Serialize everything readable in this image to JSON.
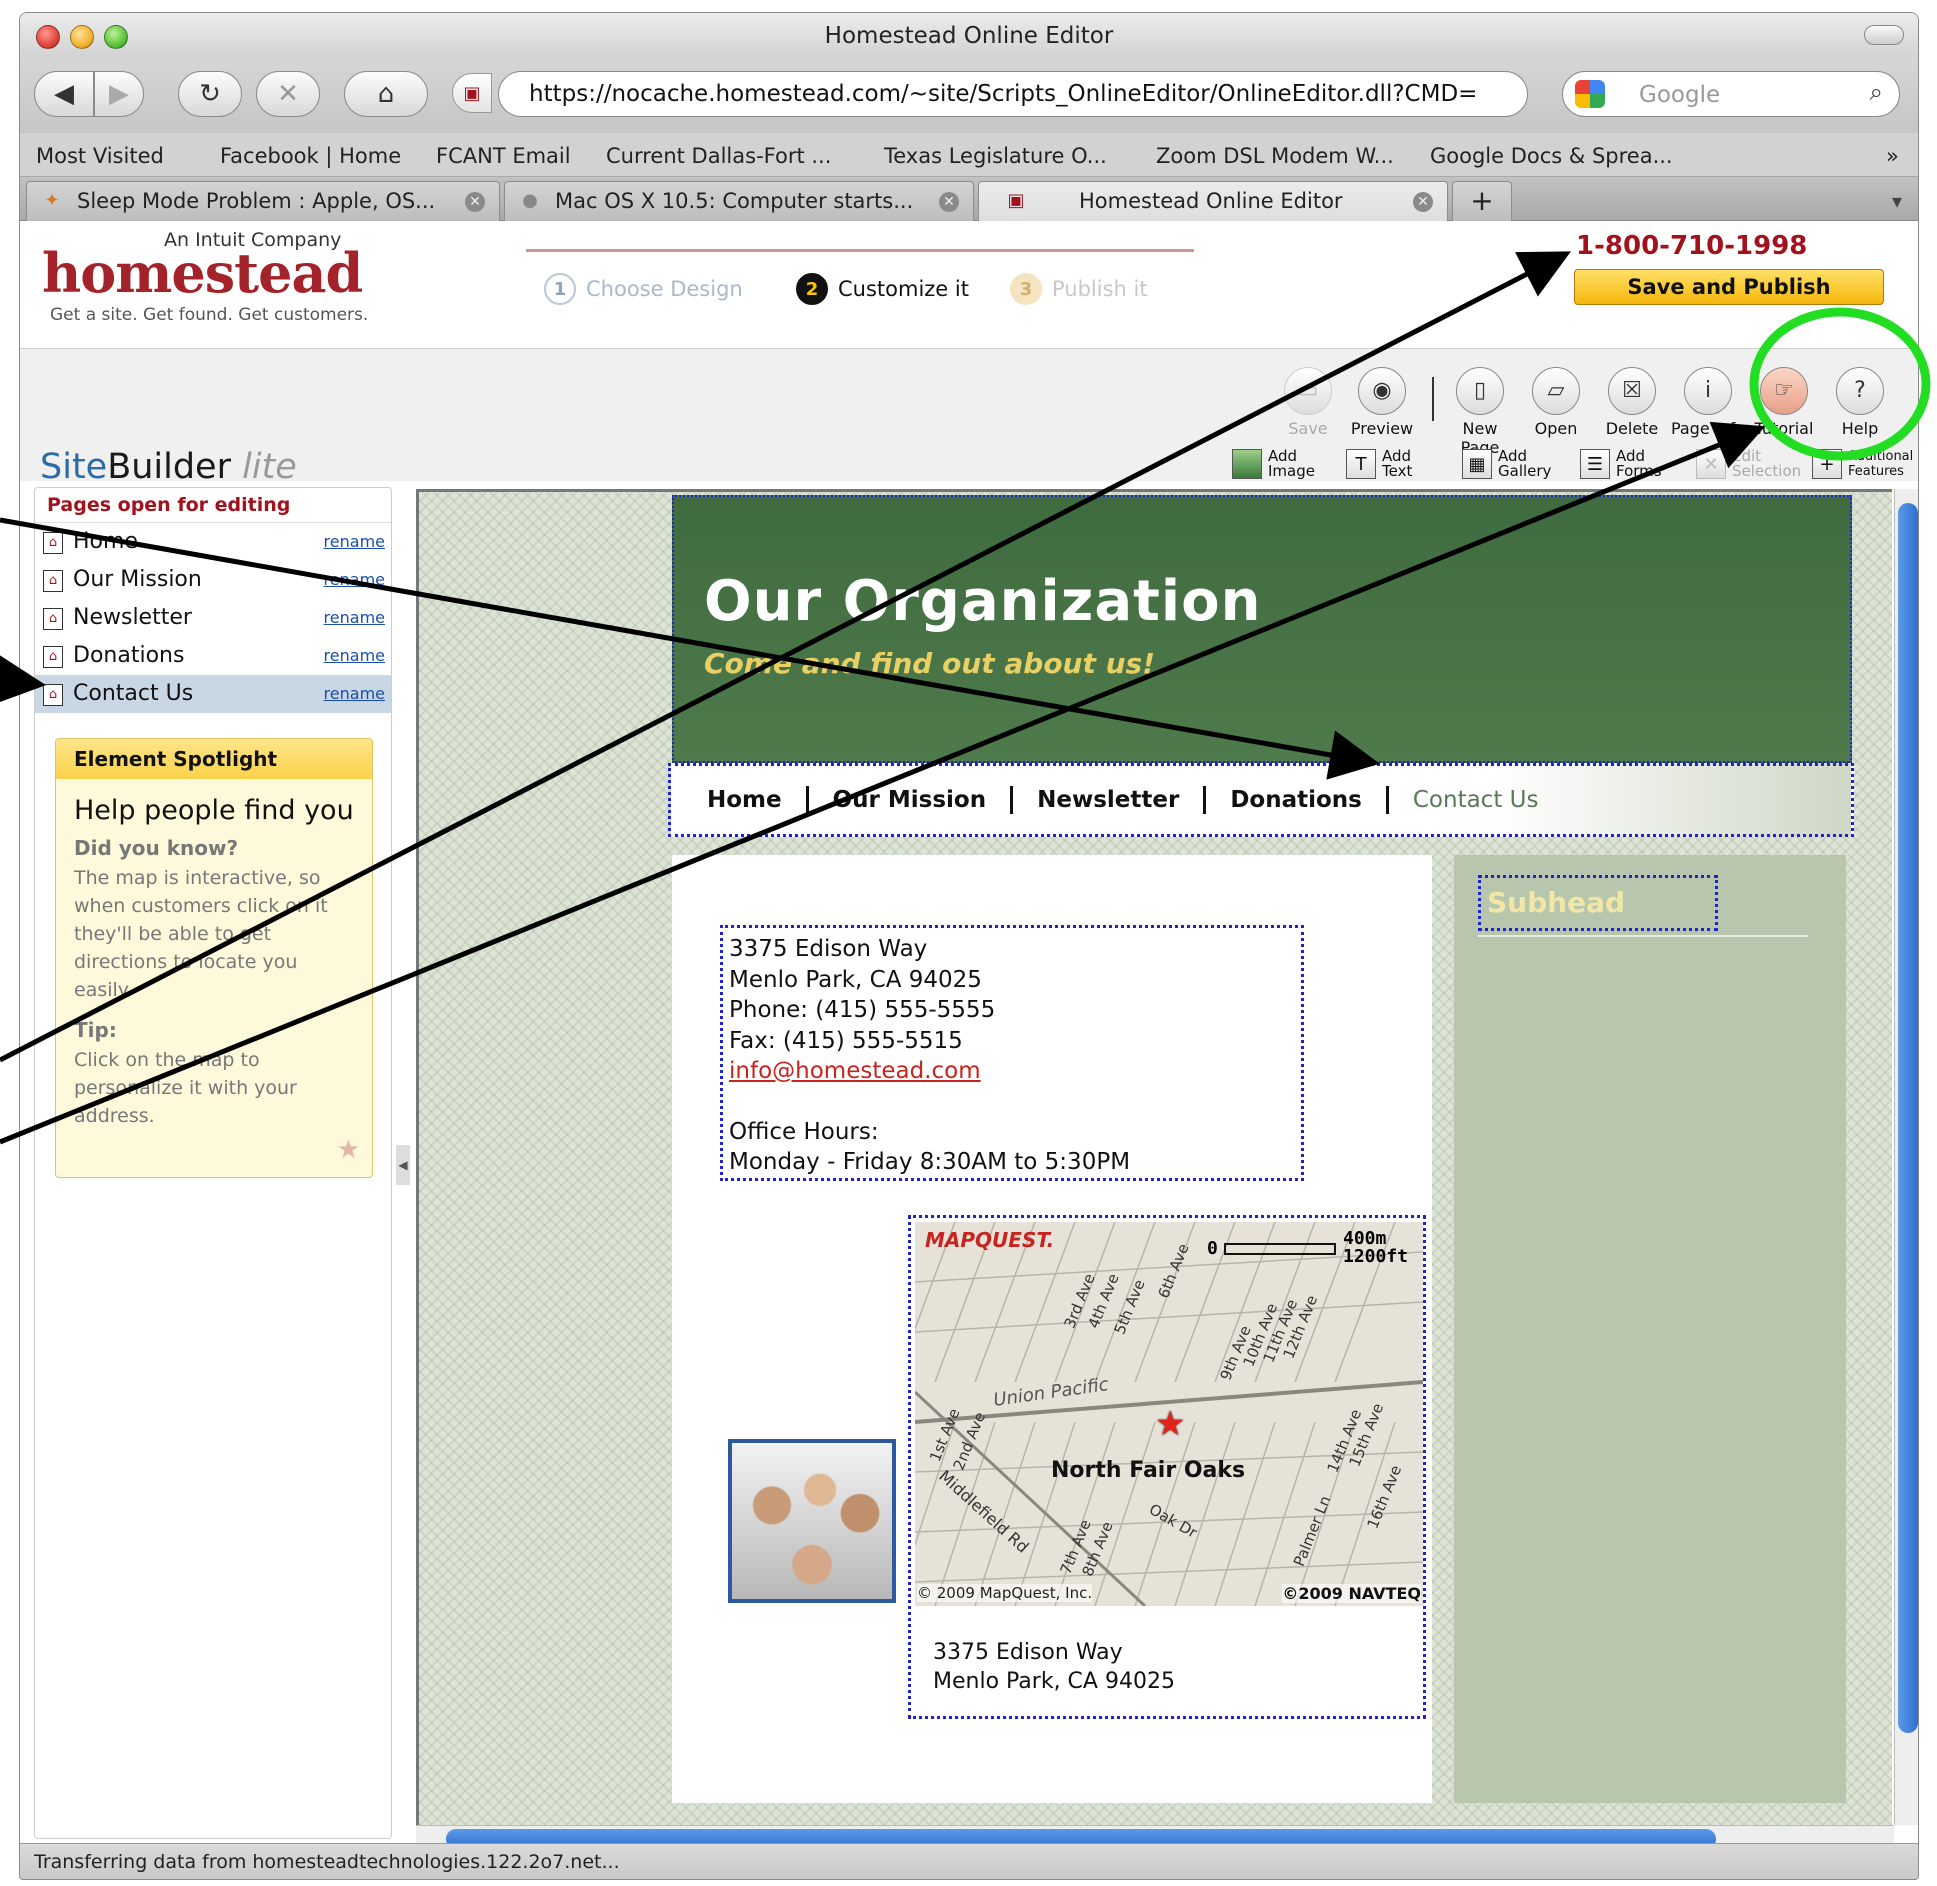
{
  "window": {
    "title": "Homestead Online Editor"
  },
  "nav": {
    "url": "https://nocache.homestead.com/~site/Scripts_OnlineEditor/OnlineEditor.dll?CMD=",
    "search_placeholder": "Google"
  },
  "bookmarks": [
    "Most Visited",
    "Facebook | Home",
    "FCANT Email",
    "Current Dallas-Fort ...",
    "Texas Legislature O...",
    "Zoom DSL Modem W...",
    "Google Docs & Sprea..."
  ],
  "tabs": [
    "Sleep Mode Problem : Apple, OS...",
    "Mac OS X 10.5: Computer starts...",
    "Homestead Online Editor"
  ],
  "header": {
    "brand_top": "An Intuit Company",
    "brand": "homestead",
    "tagline": "Get a site. Get found. Get customers.",
    "steps": [
      {
        "num": "1",
        "label": "Choose Design"
      },
      {
        "num": "2",
        "label": "Customize it"
      },
      {
        "num": "3",
        "label": "Publish it"
      }
    ],
    "phone": "1-800-710-1998",
    "publish": "Save and Publish"
  },
  "toolbar": {
    "buttons": [
      "Save",
      "Preview",
      "New Page",
      "Open",
      "Delete",
      "Page Info",
      "Tutorial",
      "Help"
    ],
    "small": [
      "Add Image",
      "Add Text",
      "Add Gallery",
      "Add Forms",
      "Edit Selection",
      "Additional Features"
    ]
  },
  "sitebuilder": {
    "site": "Site",
    "builder": "Builder",
    "lite": "lite"
  },
  "sidebar": {
    "header": "Pages open for editing",
    "pages": [
      "Home",
      "Our Mission",
      "Newsletter",
      "Donations",
      "Contact Us"
    ],
    "rename": "rename"
  },
  "spotlight": {
    "header": "Element Spotlight",
    "title": "Help people find you",
    "dyk": "Did you know?",
    "dyk_text": "The map is interactive, so when customers click on it they'll be able to get directions to locate you easily.",
    "tip": "Tip:",
    "tip_text": "Click on the map to personalize it with your address."
  },
  "site": {
    "title": "Our Organization",
    "subtitle": "Come and find out about us!",
    "nav": [
      "Home",
      "Our Mission",
      "Newsletter",
      "Donations",
      "Contact Us"
    ],
    "subhead": "Subhead",
    "address": {
      "street": "3375 Edison Way",
      "city": "Menlo Park, CA 94025",
      "phone": "Phone: (415) 555-5555",
      "fax": "Fax: (415) 555-5515",
      "email": "info@homestead.com",
      "hours_label": "Office Hours:",
      "hours": "Monday - Friday 8:30AM to 5:30PM"
    },
    "map": {
      "brand": "MAPQUEST.",
      "scale_0": "0",
      "scale_m": "400m",
      "scale_ft": "1200ft",
      "place": "North Fair Oaks",
      "rail": "Union Pacific",
      "streets": [
        "3rd Ave",
        "4th Ave",
        "5th Ave",
        "6th Ave",
        "9th Ave",
        "10th Ave",
        "11th Ave",
        "12th Ave",
        "14th Ave",
        "15th Ave",
        "16th Ave",
        "1st Ave",
        "2nd Ave",
        "7th Ave",
        "8th Ave",
        "Middlefield Rd",
        "Oak Dr",
        "Palmer Ln"
      ],
      "copyright_left": "© 2009 MapQuest, Inc.",
      "copyright_right": "©2009 NAVTEQ"
    },
    "map_address": {
      "street": "3375 Edison Way",
      "city": "Menlo Park, CA 94025"
    }
  },
  "status": "Transferring data from homesteadtechnologies.122.2o7.net..."
}
